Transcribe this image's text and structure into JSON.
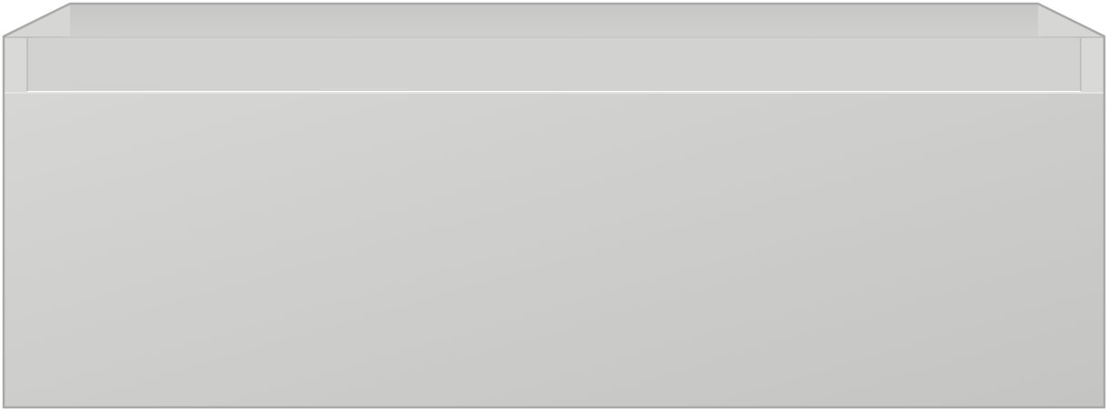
{
  "image": {
    "subject": "drawer-unit",
    "colors": {
      "background": "#ffffff",
      "outline": "#a9a9a9",
      "inner_back_wall": "#cbcbca",
      "inner_side_wall": "#d6d6d5",
      "rim_top": "#e4e4e3",
      "front_panel_light": "#d6d6d5",
      "front_panel_dark": "#c4c4c2",
      "lip_face": "#d2d2d1",
      "corner_post": "#d9d9d8",
      "seam": "#b9b9b8"
    }
  }
}
